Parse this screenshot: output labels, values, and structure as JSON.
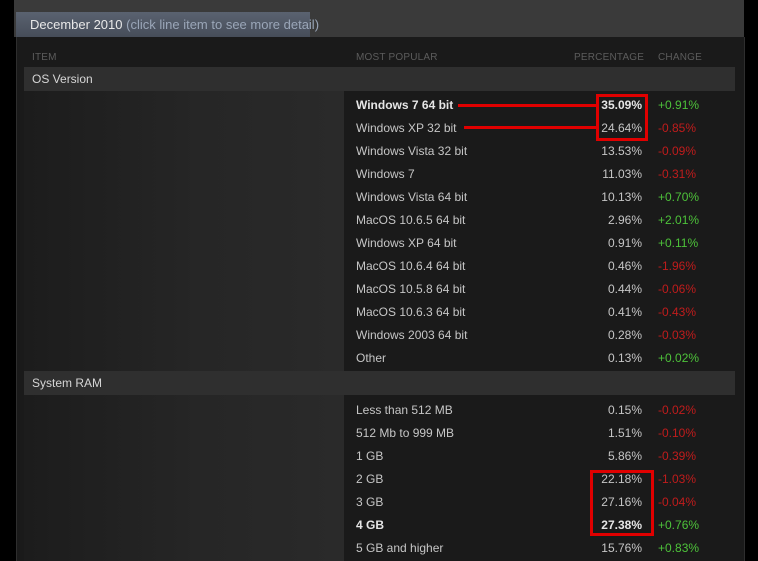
{
  "header": {
    "title": "December 2010",
    "hint": "(click line item to see more detail)"
  },
  "columns": {
    "item": "ITEM",
    "most_popular": "MOST POPULAR",
    "percentage": "PERCENTAGE",
    "change": "CHANGE"
  },
  "sections": [
    {
      "name": "OS Version",
      "rows": [
        {
          "label": "Windows 7 64 bit",
          "pct": "35.09%",
          "chg": "+0.91%",
          "dir": "pos",
          "bold": true
        },
        {
          "label": "Windows XP 32 bit",
          "pct": "24.64%",
          "chg": "-0.85%",
          "dir": "neg"
        },
        {
          "label": "Windows Vista 32 bit",
          "pct": "13.53%",
          "chg": "-0.09%",
          "dir": "neg"
        },
        {
          "label": "Windows 7",
          "pct": "11.03%",
          "chg": "-0.31%",
          "dir": "neg"
        },
        {
          "label": "Windows Vista 64 bit",
          "pct": "10.13%",
          "chg": "+0.70%",
          "dir": "pos"
        },
        {
          "label": "MacOS 10.6.5 64 bit",
          "pct": "2.96%",
          "chg": "+2.01%",
          "dir": "pos"
        },
        {
          "label": "Windows XP 64 bit",
          "pct": "0.91%",
          "chg": "+0.11%",
          "dir": "pos"
        },
        {
          "label": "MacOS 10.6.4 64 bit",
          "pct": "0.46%",
          "chg": "-1.96%",
          "dir": "neg"
        },
        {
          "label": "MacOS 10.5.8 64 bit",
          "pct": "0.44%",
          "chg": "-0.06%",
          "dir": "neg"
        },
        {
          "label": "MacOS 10.6.3 64 bit",
          "pct": "0.41%",
          "chg": "-0.43%",
          "dir": "neg"
        },
        {
          "label": "Windows 2003 64 bit",
          "pct": "0.28%",
          "chg": "-0.03%",
          "dir": "neg"
        },
        {
          "label": "Other",
          "pct": "0.13%",
          "chg": "+0.02%",
          "dir": "pos"
        }
      ]
    },
    {
      "name": "System RAM",
      "rows": [
        {
          "label": "Less than 512 MB",
          "pct": "0.15%",
          "chg": "-0.02%",
          "dir": "neg"
        },
        {
          "label": "512 Mb to 999 MB",
          "pct": "1.51%",
          "chg": "-0.10%",
          "dir": "neg"
        },
        {
          "label": "1 GB",
          "pct": "5.86%",
          "chg": "-0.39%",
          "dir": "neg"
        },
        {
          "label": "2 GB",
          "pct": "22.18%",
          "chg": "-1.03%",
          "dir": "neg"
        },
        {
          "label": "3 GB",
          "pct": "27.16%",
          "chg": "-0.04%",
          "dir": "neg"
        },
        {
          "label": "4 GB",
          "pct": "27.38%",
          "chg": "+0.76%",
          "dir": "pos",
          "bold": true
        },
        {
          "label": "5 GB and higher",
          "pct": "15.76%",
          "chg": "+0.83%",
          "dir": "pos"
        }
      ]
    }
  ],
  "colors": {
    "positive": "#4dc23a",
    "negative": "#c01c1c",
    "annotation": "#e00000"
  }
}
